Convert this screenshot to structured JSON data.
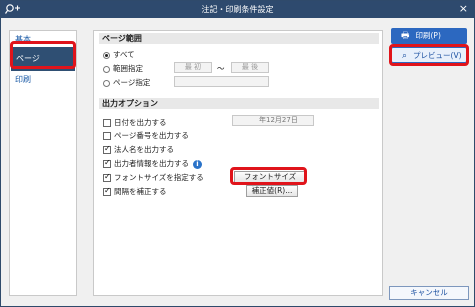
{
  "window": {
    "title": "注記・印刷条件設定",
    "close": "×"
  },
  "nav": {
    "items": [
      {
        "label": "基本"
      },
      {
        "label": "ページ"
      },
      {
        "label": "印刷"
      }
    ]
  },
  "page_range": {
    "heading": "ページ範囲",
    "all": "すべて",
    "range": "範囲指定",
    "first": "最 初",
    "tilde": "～",
    "last": "最 後",
    "page": "ページ指定"
  },
  "output": {
    "heading": "出力オプション",
    "options": [
      {
        "label": "日付を出力する",
        "checked": false
      },
      {
        "label": "ページ番号を出力する",
        "checked": false
      },
      {
        "label": "法人名を出力する",
        "checked": true
      },
      {
        "label": "出力者情報を出力する",
        "checked": true
      },
      {
        "label": "フォントサイズを指定する",
        "checked": true
      },
      {
        "label": "間隔を補正する",
        "checked": true
      }
    ],
    "date_value": "年12月27日",
    "font_button": "フォントサイズ(Z)...",
    "correction_button": "補正値(R)..."
  },
  "actions": {
    "print": "印刷(P)",
    "preview": "プレビュー(V)",
    "cancel": "キャンセル"
  },
  "colors": {
    "titlebar": "#2e4a6e",
    "accent": "#2c68c0",
    "highlight": "#e0141b"
  }
}
